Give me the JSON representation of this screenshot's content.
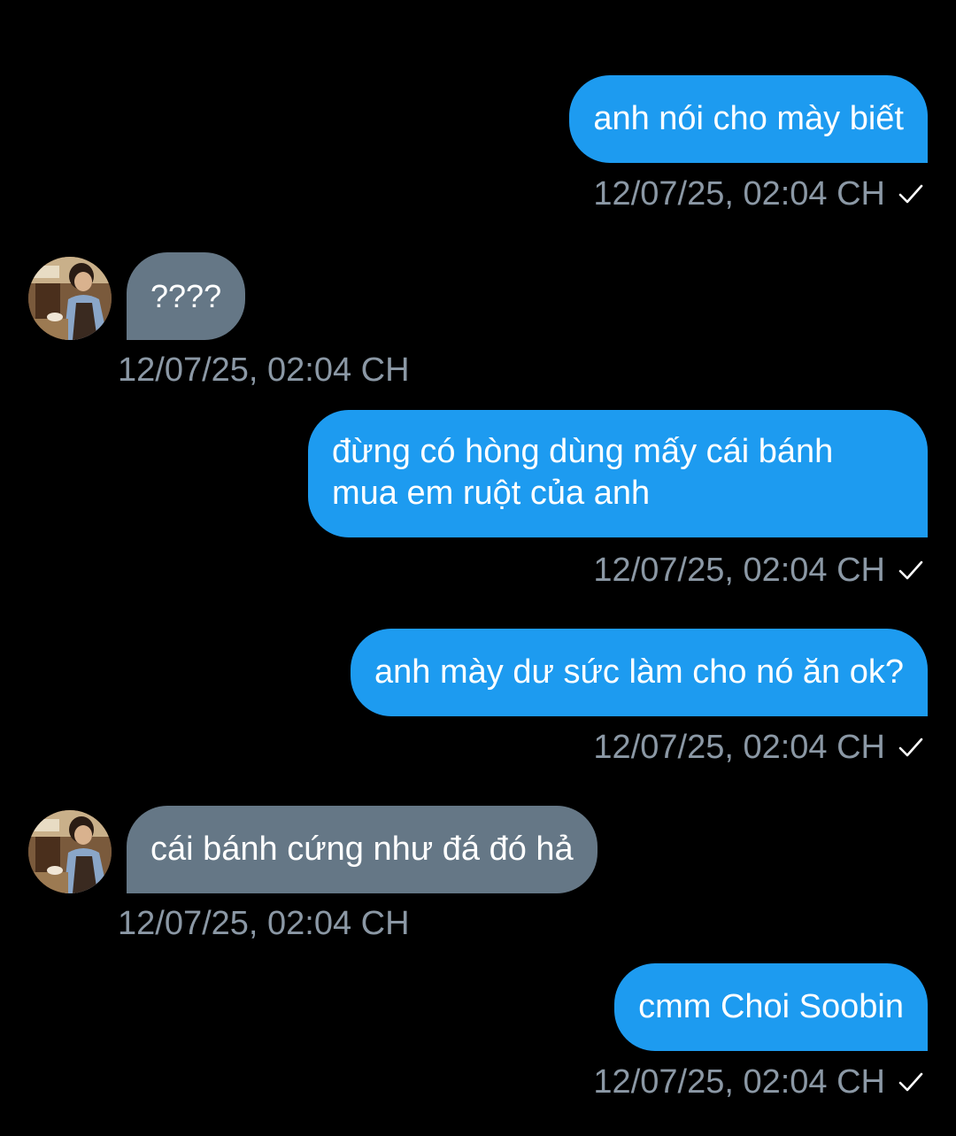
{
  "chat": {
    "messages": [
      {
        "direction": "out",
        "text": "anh nói cho mày biết",
        "time": "12/07/25, 02:04 CH",
        "status_icon": "check-icon"
      },
      {
        "direction": "in",
        "text": "????",
        "time": "12/07/25, 02:04 CH",
        "avatar_icon": "contact-avatar"
      },
      {
        "direction": "out",
        "text": "đừng có hòng dùng mấy cái bánh\nmua em ruột của anh",
        "time": "12/07/25, 02:04 CH",
        "status_icon": "check-icon"
      },
      {
        "direction": "out",
        "text": "anh mày dư sức làm cho nó ăn ok?",
        "time": "12/07/25, 02:04 CH",
        "status_icon": "check-icon"
      },
      {
        "direction": "in",
        "text": "cái bánh cứng như đá đó hả",
        "time": "12/07/25, 02:04 CH",
        "avatar_icon": "contact-avatar"
      },
      {
        "direction": "out",
        "text": "cmm Choi Soobin",
        "time": "12/07/25, 02:04 CH",
        "status_icon": "check-icon"
      }
    ]
  },
  "colors": {
    "background": "#000000",
    "outgoing_bubble": "#1d9bf0",
    "incoming_bubble": "#657786",
    "timestamp": "#8b98a5",
    "text": "#ffffff"
  }
}
